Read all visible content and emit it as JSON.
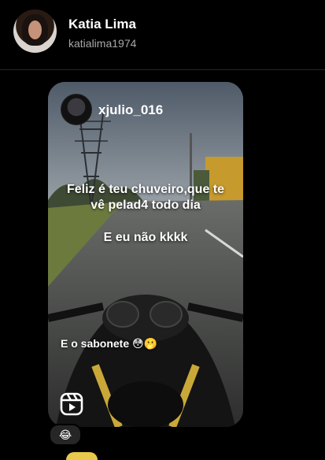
{
  "header": {
    "display_name": "Katia Lima",
    "handle": "katialima1974"
  },
  "reel": {
    "author": "xjulio_016",
    "caption_line1": "Feliz é teu chuveiro,que te",
    "caption_line2": "vê pelad4 todo dia",
    "caption_line3": "E eu não kkkk",
    "overlay_text": "E o sabonete 😳🫢",
    "type_icon": "reels-icon"
  },
  "reaction": {
    "emoji": "😂"
  }
}
